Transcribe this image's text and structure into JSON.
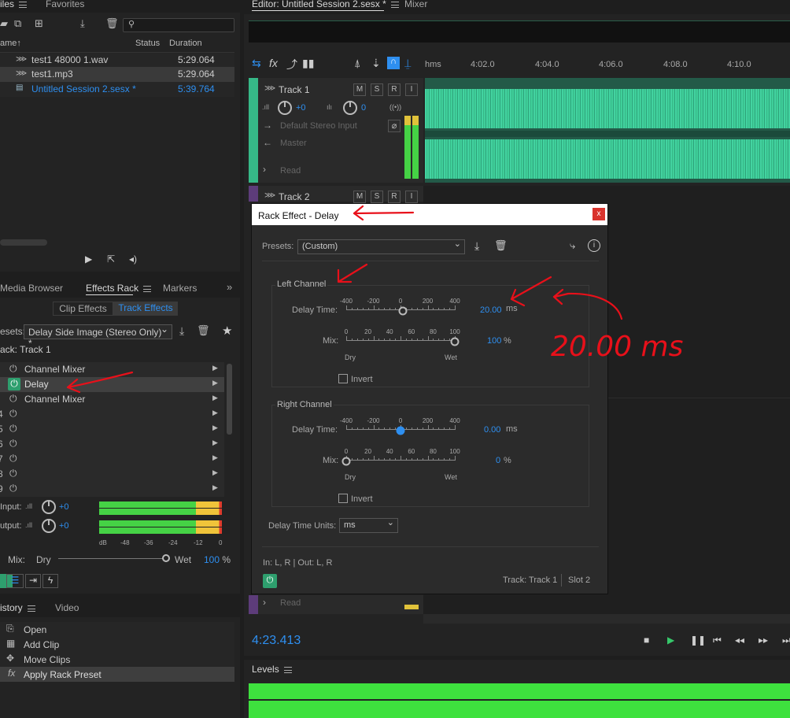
{
  "files_panel": {
    "tab_files": "iles",
    "tab_favorites": "Favorites",
    "col_name": "ame",
    "col_status": "Status",
    "col_duration": "Duration",
    "files": [
      {
        "name": "test1 48000 1.wav",
        "duration": "5:29.064"
      },
      {
        "name": "test1.mp3",
        "duration": "5:29.064"
      },
      {
        "name": "Untitled Session 2.sesx *",
        "duration": "5:39.764"
      }
    ]
  },
  "effects_panel": {
    "tab_media": "Media Browser",
    "tab_effects": "Effects Rack",
    "tab_markers": "Markers",
    "clip_effects": "Clip Effects",
    "track_effects": "Track Effects",
    "presets_label": "esets:",
    "presets_value": "Delay Side Image (Stereo Only) *",
    "track_label": "ack: Track 1",
    "slots": [
      {
        "num": "",
        "name": "Channel Mixer"
      },
      {
        "num": "",
        "name": "Delay"
      },
      {
        "num": "",
        "name": "Channel Mixer"
      },
      {
        "num": "4",
        "name": ""
      },
      {
        "num": "5",
        "name": ""
      },
      {
        "num": "6",
        "name": ""
      },
      {
        "num": "7",
        "name": ""
      },
      {
        "num": "8",
        "name": ""
      },
      {
        "num": "9",
        "name": ""
      }
    ],
    "input_label": "Input:",
    "input_val": "+0",
    "output_label": "utput:",
    "output_val": "+0",
    "meter_ticks": [
      "dB",
      "-48",
      "-36",
      "-24",
      "-12",
      "0"
    ],
    "mix_label": "Mix:",
    "mix_dry": "Dry",
    "mix_wet": "Wet",
    "mix_val": "100",
    "mix_unit": "%"
  },
  "history_panel": {
    "tab_history": "istory",
    "tab_video": "Video",
    "items": [
      "Open",
      "Add Clip",
      "Move Clips",
      "Apply Rack Preset"
    ]
  },
  "editor": {
    "tab": "Editor: Untitled Session 2.sesx *",
    "tab_mixer": "Mixer",
    "ruler": [
      "hms",
      "4:02.0",
      "4:04.0",
      "4:06.0",
      "4:08.0",
      "4:10.0"
    ],
    "track1": {
      "name": "Track 1",
      "vol": "+0",
      "pan": "0",
      "input": "Default Stereo Input",
      "output": "Master",
      "mode": "Read"
    },
    "track2": {
      "name": "Track 2",
      "mode": "Read"
    },
    "time": "4:23.413",
    "levels": "Levels",
    "accent": "#2e8ff0",
    "wave_color": "#36b887"
  },
  "dialog": {
    "title": "Rack Effect - Delay",
    "presets_label": "Presets:",
    "presets_value": "(Custom)",
    "left": {
      "title": "Left Channel",
      "delay_label": "Delay Time:",
      "delay_val": "20.00",
      "delay_unit": "ms",
      "delay_pos": 0.52,
      "mix_label": "Mix:",
      "mix_val": "100",
      "mix_unit": "%",
      "mix_pos": 1.0,
      "invert": "Invert"
    },
    "right": {
      "title": "Right Channel",
      "delay_label": "Delay Time:",
      "delay_val": "0.00",
      "delay_unit": "ms",
      "delay_pos": 0.5,
      "mix_label": "Mix:",
      "mix_val": "0",
      "mix_unit": "%",
      "mix_pos": 0.0,
      "invert": "Invert"
    },
    "delay_ticks": [
      "-400",
      "-200",
      "0",
      "200",
      "400"
    ],
    "mix_ticks": [
      "0",
      "20",
      "40",
      "60",
      "80",
      "100"
    ],
    "dry": "Dry",
    "wet": "Wet",
    "units_label": "Delay Time Units:",
    "units_value": "ms",
    "io": "In: L, R | Out: L, R",
    "track": "Track: Track 1",
    "slot": "Slot 2"
  },
  "annotation": {
    "handwritten": "20.00 ms"
  }
}
